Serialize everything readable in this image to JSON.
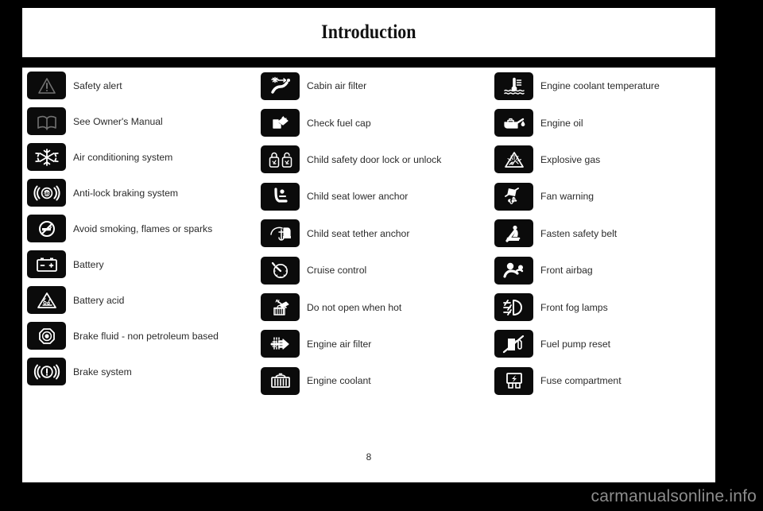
{
  "header": {
    "title": "Introduction"
  },
  "page": {
    "number": "8",
    "watermark": "carmanualsonline.info",
    "background_color": "#000000",
    "sheet_color": "#ffffff",
    "icon_color": "#0b0b0b",
    "label_color": "#2b2b2b",
    "watermark_color": "#8d8d8d"
  },
  "columns": [
    {
      "index": 0,
      "rows": [
        {
          "label": "Safety alert",
          "icon": "safety-alert-triangle-icon"
        },
        {
          "label": "See Owner's Manual",
          "icon": "owners-manual-book-icon"
        },
        {
          "label": "Air conditioning system",
          "icon": "snowflake-icon"
        },
        {
          "label": "Anti-lock braking system",
          "icon": "abs-icon"
        },
        {
          "label": "Avoid smoking, flames or sparks",
          "icon": "no-smoking-icon"
        },
        {
          "label": "Battery",
          "icon": "battery-icon"
        },
        {
          "label": "Battery acid",
          "icon": "battery-acid-warning-icon"
        },
        {
          "label": "Brake fluid - non petroleum based",
          "icon": "brake-fluid-icon"
        },
        {
          "label": "Brake system",
          "icon": "brake-system-icon"
        }
      ]
    },
    {
      "index": 1,
      "rows": [
        {
          "label": "Cabin air filter",
          "icon": "cabin-air-filter-icon"
        },
        {
          "label": "Check fuel cap",
          "icon": "check-fuel-cap-icon"
        },
        {
          "label": "Child safety door lock or unlock",
          "icon": "child-safety-door-lock-icon"
        },
        {
          "label": "Child seat lower anchor",
          "icon": "child-seat-lower-anchor-icon"
        },
        {
          "label": "Child seat tether anchor",
          "icon": "child-seat-tether-anchor-icon"
        },
        {
          "label": "Cruise control",
          "icon": "cruise-control-icon"
        },
        {
          "label": "Do not open when hot",
          "icon": "do-not-open-when-hot-icon"
        },
        {
          "label": "Engine air filter",
          "icon": "engine-air-filter-icon"
        },
        {
          "label": "Engine coolant",
          "icon": "engine-coolant-icon"
        }
      ]
    },
    {
      "index": 2,
      "rows": [
        {
          "label": "Engine coolant temperature",
          "icon": "engine-coolant-temperature-icon"
        },
        {
          "label": "Engine oil",
          "icon": "engine-oil-can-icon"
        },
        {
          "label": "Explosive gas",
          "icon": "explosive-gas-warning-icon"
        },
        {
          "label": "Fan warning",
          "icon": "fan-warning-icon"
        },
        {
          "label": "Fasten safety belt",
          "icon": "fasten-safety-belt-icon"
        },
        {
          "label": "Front airbag",
          "icon": "front-airbag-icon"
        },
        {
          "label": "Front fog lamps",
          "icon": "front-fog-lamps-icon"
        },
        {
          "label": "Fuel pump reset",
          "icon": "fuel-pump-reset-icon"
        },
        {
          "label": "Fuse compartment",
          "icon": "fuse-compartment-icon"
        }
      ]
    }
  ]
}
